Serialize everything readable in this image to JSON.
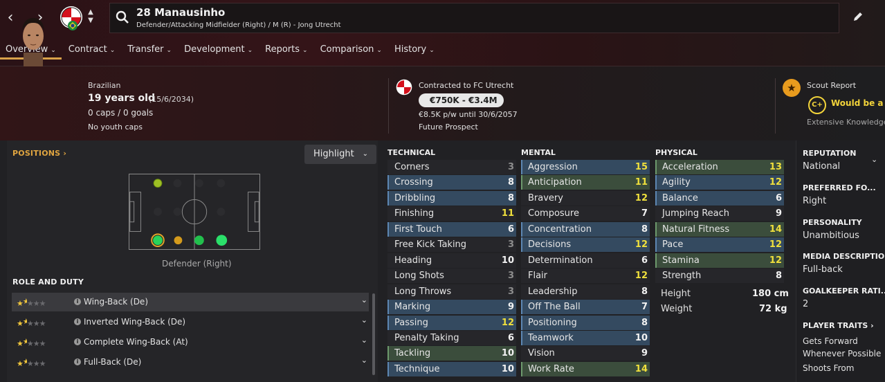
{
  "header": {
    "player_name": "28 Manausinho",
    "player_subtitle": "Defender/Attacking Midfielder (Right) / M (R) - Jong Utrecht"
  },
  "tabs": [
    {
      "label": "Overview",
      "active": true
    },
    {
      "label": "Contract"
    },
    {
      "label": "Transfer"
    },
    {
      "label": "Development"
    },
    {
      "label": "Reports"
    },
    {
      "label": "Comparison"
    },
    {
      "label": "History"
    }
  ],
  "info": {
    "nationality": "Brazilian",
    "age": "19 years old",
    "dob": "(15/6/2034)",
    "caps": "0 caps / 0 goals",
    "youth_caps": "No youth caps",
    "contract": "Contracted to FC Utrecht",
    "value": "€750K - €3.4M",
    "wage": "€8.5K p/w until 30/6/2057",
    "status": "Future Prospect",
    "scout_title": "Scout Report",
    "scout_grade": "C+",
    "scout_verdict": "Would be a g",
    "scout_knowledge": "Extensive Knowledge"
  },
  "positions": {
    "title": "POSITIONS",
    "highlight": "Highlight",
    "caption": "Defender (Right)"
  },
  "role": {
    "title": "ROLE AND DUTY",
    "items": [
      {
        "label": "Wing-Back (De)",
        "stars": 1.5
      },
      {
        "label": "Inverted Wing-Back (De)",
        "stars": 1.5
      },
      {
        "label": "Complete Wing-Back (At)",
        "stars": 1.5
      },
      {
        "label": "Full-Back (De)",
        "stars": 1.5
      }
    ]
  },
  "attributes": {
    "technical_title": "TECHNICAL",
    "mental_title": "MENTAL",
    "physical_title": "PHYSICAL",
    "technical": [
      {
        "name": "Corners",
        "value": "3"
      },
      {
        "name": "Crossing",
        "value": "8"
      },
      {
        "name": "Dribbling",
        "value": "8"
      },
      {
        "name": "Finishing",
        "value": "11"
      },
      {
        "name": "First Touch",
        "value": "6"
      },
      {
        "name": "Free Kick Taking",
        "value": "3"
      },
      {
        "name": "Heading",
        "value": "10"
      },
      {
        "name": "Long Shots",
        "value": "3"
      },
      {
        "name": "Long Throws",
        "value": "3"
      },
      {
        "name": "Marking",
        "value": "9"
      },
      {
        "name": "Passing",
        "value": "12"
      },
      {
        "name": "Penalty Taking",
        "value": "6"
      },
      {
        "name": "Tackling",
        "value": "10"
      },
      {
        "name": "Technique",
        "value": "10"
      }
    ],
    "mental": [
      {
        "name": "Aggression",
        "value": "15"
      },
      {
        "name": "Anticipation",
        "value": "11"
      },
      {
        "name": "Bravery",
        "value": "12"
      },
      {
        "name": "Composure",
        "value": "7"
      },
      {
        "name": "Concentration",
        "value": "8"
      },
      {
        "name": "Decisions",
        "value": "12"
      },
      {
        "name": "Determination",
        "value": "6"
      },
      {
        "name": "Flair",
        "value": "12"
      },
      {
        "name": "Leadership",
        "value": "8"
      },
      {
        "name": "Off The Ball",
        "value": "7"
      },
      {
        "name": "Positioning",
        "value": "8"
      },
      {
        "name": "Teamwork",
        "value": "10"
      },
      {
        "name": "Vision",
        "value": "9"
      },
      {
        "name": "Work Rate",
        "value": "14"
      }
    ],
    "physical": [
      {
        "name": "Acceleration",
        "value": "13"
      },
      {
        "name": "Agility",
        "value": "12"
      },
      {
        "name": "Balance",
        "value": "6"
      },
      {
        "name": "Jumping Reach",
        "value": "9"
      },
      {
        "name": "Natural Fitness",
        "value": "14"
      },
      {
        "name": "Pace",
        "value": "12"
      },
      {
        "name": "Stamina",
        "value": "12"
      },
      {
        "name": "Strength",
        "value": "8"
      }
    ],
    "height_label": "Height",
    "height": "180 cm",
    "weight_label": "Weight",
    "weight": "72 kg"
  },
  "side": {
    "reputation_label": "REPUTATION",
    "reputation": "National",
    "foot_label": "PREFERRED FO...",
    "foot": "Right",
    "personality_label": "PERSONALITY",
    "personality": "Unambitious",
    "media_label": "MEDIA DESCRIPTION",
    "media": "Full-back",
    "gk_label": "GOALKEEPER RATI...",
    "gk": "2",
    "traits_label": "PLAYER TRAITS",
    "trait1a": "Gets Forward",
    "trait1b": "Whenever Possible",
    "trait2": "Shoots From"
  },
  "colors": {
    "accent": "#d9a24a",
    "value_yellow": "#f0e03c",
    "row_blue": "#344a60",
    "row_green": "#3b4d3c",
    "row_plain": "#26262a"
  }
}
